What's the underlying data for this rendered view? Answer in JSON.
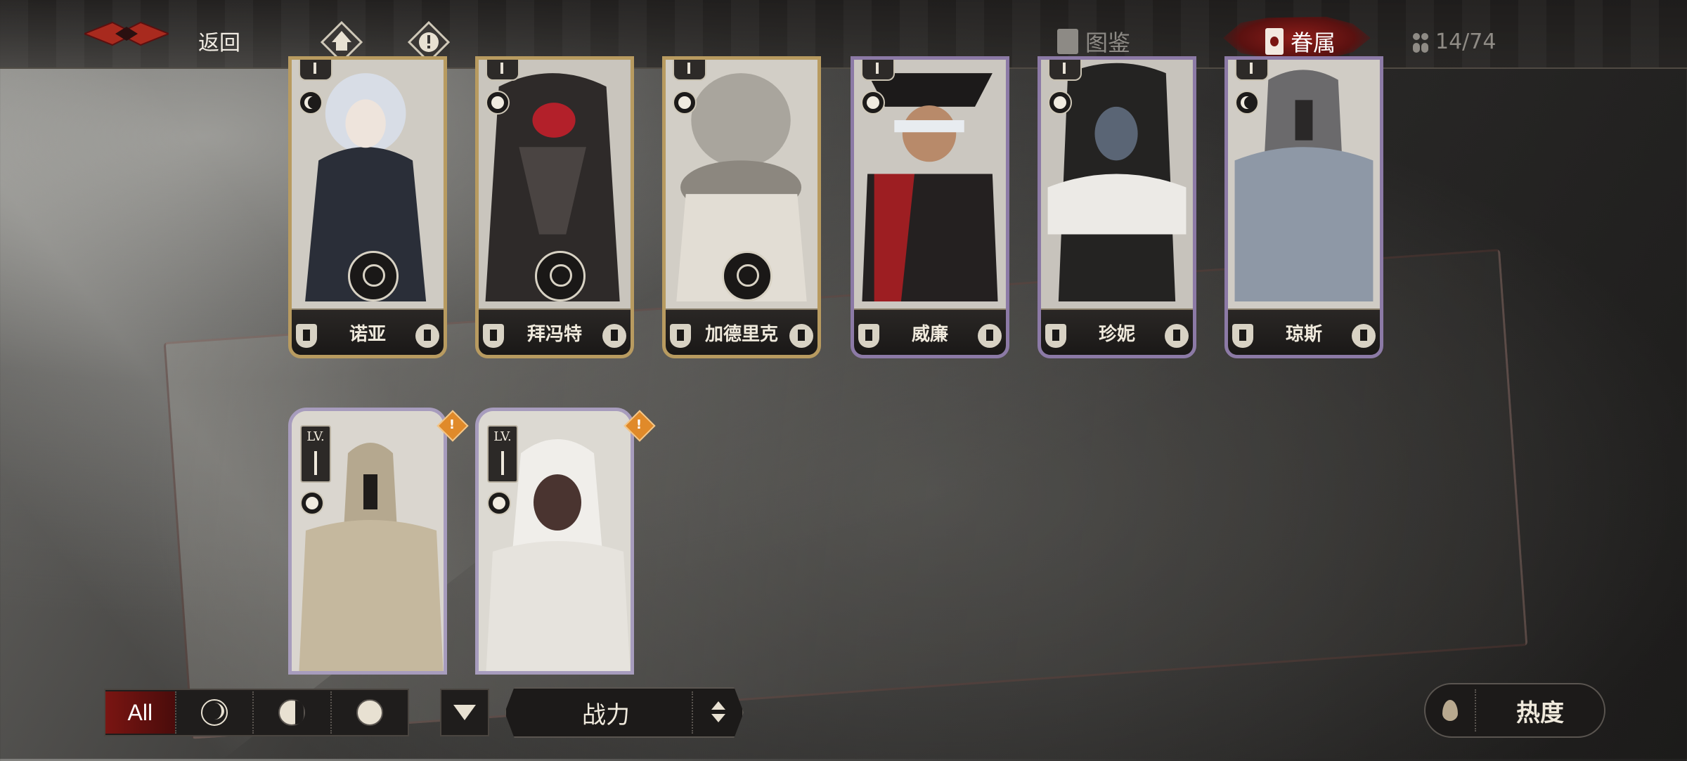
{
  "topbar": {
    "back_label": "返回",
    "tabs": [
      {
        "label": "图鉴",
        "active": false
      },
      {
        "label": "眷属",
        "active": true
      }
    ],
    "count": "14/74"
  },
  "roster": [
    {
      "name": "诺亚",
      "frame": "gold",
      "phase": "crescent"
    },
    {
      "name": "拜冯特",
      "frame": "gold",
      "phase": "full"
    },
    {
      "name": "加德里克",
      "frame": "gold",
      "phase": "full"
    },
    {
      "name": "威廉",
      "frame": "purple",
      "phase": "full"
    },
    {
      "name": "珍妮",
      "frame": "purple",
      "phase": "full"
    },
    {
      "name": "琼斯",
      "frame": "purple",
      "phase": "crescent"
    }
  ],
  "new_cards": [
    {
      "lv_label": "LV.",
      "alert": "!"
    },
    {
      "lv_label": "LV.",
      "alert": "!"
    }
  ],
  "filters": {
    "all_label": "All",
    "phases": [
      "crescent",
      "gibbous",
      "full"
    ]
  },
  "sort": {
    "label": "战力"
  },
  "heat": {
    "label": "热度"
  },
  "colors": {
    "accent_red": "#7a1512",
    "gold_frame": "#b89b60",
    "purple_frame": "#8c7aa6"
  }
}
